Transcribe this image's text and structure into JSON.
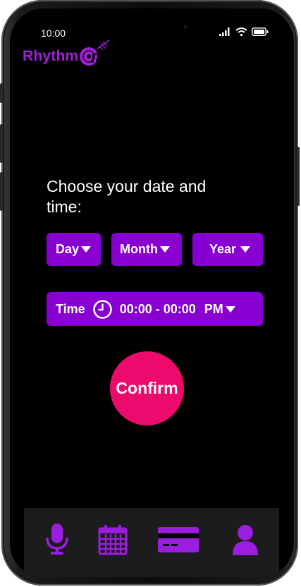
{
  "status_bar": {
    "time": "10:00"
  },
  "app": {
    "logo_text": "Rhythm",
    "brand_color": "#a01fd8",
    "accent_color": "#8800d1",
    "confirm_color": "#ec0a6c"
  },
  "main": {
    "prompt": "Choose your date and time:",
    "day_label": "Day",
    "month_label": "Month",
    "year_label": "Year",
    "time_label": "Time",
    "time_range": "00:00 - 00:00",
    "meridiem": "PM",
    "confirm_label": "Confirm"
  },
  "bottom_nav": {
    "items": [
      {
        "icon": "microphone-icon"
      },
      {
        "icon": "calendar-icon"
      },
      {
        "icon": "credit-card-icon"
      },
      {
        "icon": "user-icon"
      }
    ]
  }
}
